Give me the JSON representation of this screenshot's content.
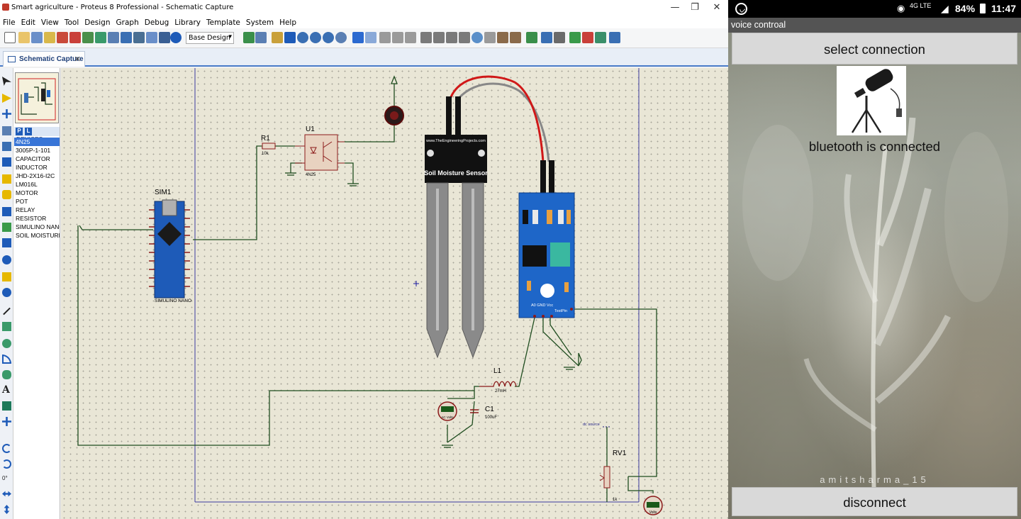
{
  "window": {
    "title": "Smart agriculture - Proteus 8 Professional - Schematic Capture",
    "minimize": "—",
    "maximize": "❐",
    "close": "✕"
  },
  "menu": [
    "File",
    "Edit",
    "View",
    "Tool",
    "Design",
    "Graph",
    "Debug",
    "Library",
    "Template",
    "System",
    "Help"
  ],
  "toolbar": {
    "design_select": "Base Design"
  },
  "tab": {
    "label": "Schematic Capture",
    "close": "✕"
  },
  "devices": {
    "header": "DEVICES",
    "p_button": "P",
    "l_button": "L",
    "items": [
      "4N25",
      "3005P-1-101",
      "CAPACITOR",
      "INDUCTOR",
      "JHD-2X16-I2C",
      "LM016L",
      "MOTOR",
      "POT",
      "RELAY",
      "RESISTOR",
      "SIMULINO NANO",
      "SOIL MOISTURE"
    ],
    "selected": "4N25"
  },
  "schematic": {
    "r1_ref": "R1",
    "r1_val": "10k",
    "u1_ref": "U1",
    "u1_part": "4N25",
    "sim1_ref": "SIM1",
    "sim1_part": "SIMULINO NANO",
    "sensor_url": "www.TheEngineeringProjects.com",
    "sensor_name": "Soil Moisture Sensor",
    "module_pins": "A0   GND  Vcc",
    "module_testpin": "TestPin",
    "l1_ref": "L1",
    "l1_val": "27mH",
    "c1_ref": "C1",
    "c1_val": "100uF",
    "meter1": "AC Volts",
    "rv1_ref": "RV1",
    "rv1_val": "1k",
    "dc_source": "dc source",
    "meter2": "Volts"
  },
  "phone": {
    "status_time": "11:47",
    "status_battery": "84%",
    "status_network": "4G LTE",
    "app_title": "voice controal",
    "select_button": "select connection",
    "bt_status": "bluetooth is connected",
    "watermark": "amitsharma_15",
    "disconnect_button": "disconnect"
  },
  "colors": {
    "canvas": "#e9e6d6",
    "wire": "#1f4d1f",
    "sensor_blue": "#1e66c8",
    "selected_item": "#3875d7",
    "phone_button": "#d9d9d9"
  }
}
